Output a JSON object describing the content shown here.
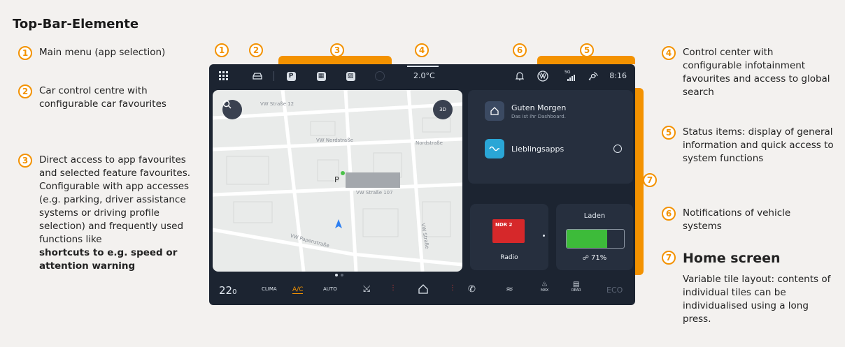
{
  "title": "Top-Bar-Elemente",
  "legend_left": [
    {
      "num": "1",
      "text": "Main menu (app selection)"
    },
    {
      "num": "2",
      "text": "Car control centre with configurable car favourites"
    },
    {
      "num": "3",
      "text": "Direct access to app favourites and selected feature favourites. Configurable with app accesses (e.g. parking, driver assistance systems or driving profile selection) and frequently used functions like",
      "bold": "shortcuts to e.g. speed or attention warning"
    }
  ],
  "legend_right": [
    {
      "num": "4",
      "text": "Control center with configurable infotainment favourites and access to global search"
    },
    {
      "num": "5",
      "text": "Status items: display of general information and quick access to system functions"
    },
    {
      "num": "6",
      "text": "Notifications of vehicle systems"
    },
    {
      "num": "7",
      "heading": "Home screen",
      "text": "Variable tile layout: contents of individual tiles can be individualised using a long press."
    }
  ],
  "callouts": {
    "n1": "1",
    "n2": "2",
    "n3": "3",
    "n4": "4",
    "n5": "5",
    "n6": "6",
    "n7": "7"
  },
  "screen": {
    "topbar": {
      "parking_label": "P",
      "temperature": "2.0°C",
      "time": "8:16",
      "signal": "5G"
    },
    "map": {
      "streets": [
        "VW Straße 12",
        "VW Nordstraße",
        "Nordstraße",
        "VW Straße 107",
        "VW Papenstraße",
        "VW Straße"
      ],
      "parking_marker": "P",
      "compass_label": "3D"
    },
    "tiles": {
      "greeting": "Guten Morgen",
      "greeting_sub": "Das ist Ihr Dashboard.",
      "favorites": "Lieblingsapps",
      "radio_logo": "NDR 2",
      "radio_label": "Radio",
      "charge_title": "Laden",
      "charge_percent": "71%",
      "charge_level": 0.71
    },
    "bottombar": {
      "temp": "22",
      "temp_decimal": "0",
      "clima": "CLIMA",
      "ac": "A/C",
      "auto": "AUTO",
      "max": "MAX",
      "rear": "REAR",
      "eco": "ECO"
    }
  },
  "colors": {
    "accent": "#f39200",
    "screen_bg": "#1c2431",
    "tile_bg": "#262f3e",
    "battery": "#3dbb3a"
  }
}
